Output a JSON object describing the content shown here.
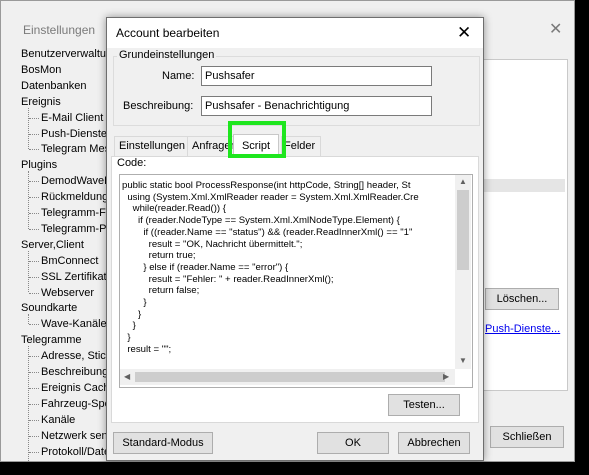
{
  "background_window": {
    "title": "Einstellungen",
    "close_glyph": "✕",
    "tree": [
      {
        "label": "Benutzerverwaltung",
        "level": 1
      },
      {
        "label": "BosMon",
        "level": 1
      },
      {
        "label": "Datenbanken",
        "level": 1
      },
      {
        "label": "Ereignis",
        "level": 1
      },
      {
        "label": "E-Mail Client",
        "level": 2
      },
      {
        "label": "Push-Dienste",
        "level": 2
      },
      {
        "label": "Telegram Messenger",
        "level": 2
      },
      {
        "label": "Plugins",
        "level": 1
      },
      {
        "label": "DemodWaveE",
        "level": 2
      },
      {
        "label": "Rückmeldung",
        "level": 2
      },
      {
        "label": "Telegramm-Fe",
        "level": 2
      },
      {
        "label": "Telegramm-Po",
        "level": 2
      },
      {
        "label": "Server,Client",
        "level": 1
      },
      {
        "label": "BmConnect",
        "level": 2
      },
      {
        "label": "SSL Zertifikate",
        "level": 2
      },
      {
        "label": "Webserver",
        "level": 2
      },
      {
        "label": "Soundkarte",
        "level": 1
      },
      {
        "label": "Wave-Kanäle",
        "level": 2
      },
      {
        "label": "Telegramme",
        "level": 1
      },
      {
        "label": "Adresse, Stich",
        "level": 2
      },
      {
        "label": "Beschreibung",
        "level": 2
      },
      {
        "label": "Ereignis Cache",
        "level": 2
      },
      {
        "label": "Fahrzeug-Spez",
        "level": 2
      },
      {
        "label": "Kanäle",
        "level": 2
      },
      {
        "label": "Netzwerk send",
        "level": 2
      },
      {
        "label": "Protokoll/Date",
        "level": 2
      }
    ],
    "delete_button": "Löschen...",
    "push_link": "Push-Dienste...",
    "close_button": "Schließen"
  },
  "dialog": {
    "title": "Account bearbeiten",
    "close_glyph": "✕",
    "group_label": "Grundeinstellungen",
    "name_label": "Name:",
    "name_value": "Pushsafer",
    "desc_label": "Beschreibung:",
    "desc_value": "Pushsafer - Benachrichtigung",
    "tabs": [
      "Einstellungen",
      "Anfragen",
      "Script",
      "Felder"
    ],
    "active_tab": "Script",
    "code_label": "Code:",
    "code_lines": [
      "public static bool ProcessResponse(int httpCode, String[] header, St",
      "  using (System.Xml.XmlReader reader = System.Xml.XmlReader.Cre",
      "    while(reader.Read()) {",
      "      if (reader.NodeType == System.Xml.XmlNodeType.Element) {",
      "        if ((reader.Name == \"status\") && (reader.ReadInnerXml() == \"1\"",
      "          result = \"OK, Nachricht übermittelt.\";",
      "          return true;",
      "        } else if (reader.Name == \"error\") {",
      "          result = \"Fehler: \" + reader.ReadInnerXml();",
      "          return false;",
      "        }",
      "      }",
      "    }",
      "  }",
      "  result = \"\";"
    ],
    "test_button": "Testen...",
    "standard_button": "Standard-Modus",
    "ok_button": "OK",
    "cancel_button": "Abbrechen"
  },
  "colors": {
    "highlight": "#1ee61e",
    "link": "#0000ee"
  }
}
